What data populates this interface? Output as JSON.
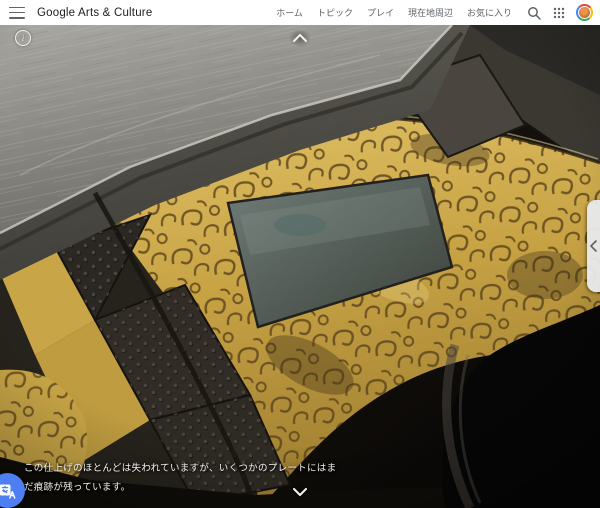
{
  "header": {
    "logo": "Google Arts & Culture",
    "nav_items": [
      {
        "label": "ホーム"
      },
      {
        "label": "トピック"
      },
      {
        "label": "プレイ"
      },
      {
        "label": "現在地周辺"
      },
      {
        "label": "お気に入り"
      }
    ]
  },
  "viewer": {
    "caption_line1": "この仕上げのほとんどは失われていますが、いくつかのプレートにはま",
    "caption_line2": "だ痕跡が残っています。"
  },
  "icons": {
    "menu": "hamburger",
    "search": "magnifier",
    "apps": "grid-3x3",
    "avatar": "profile-photo",
    "info": "info-circle",
    "scroll_up": "chevron-up",
    "scroll_down": "chevron-down",
    "translate": "google-translate",
    "side_panel": "chevron-left"
  },
  "colors": {
    "header_text": "#5f6368",
    "logo_text": "#202124",
    "gold_band": "#c9a44c",
    "translate_button": "#4d7ef2",
    "side_panel_bg": "#e8eaed",
    "caption_text": "#f4f3f1"
  }
}
